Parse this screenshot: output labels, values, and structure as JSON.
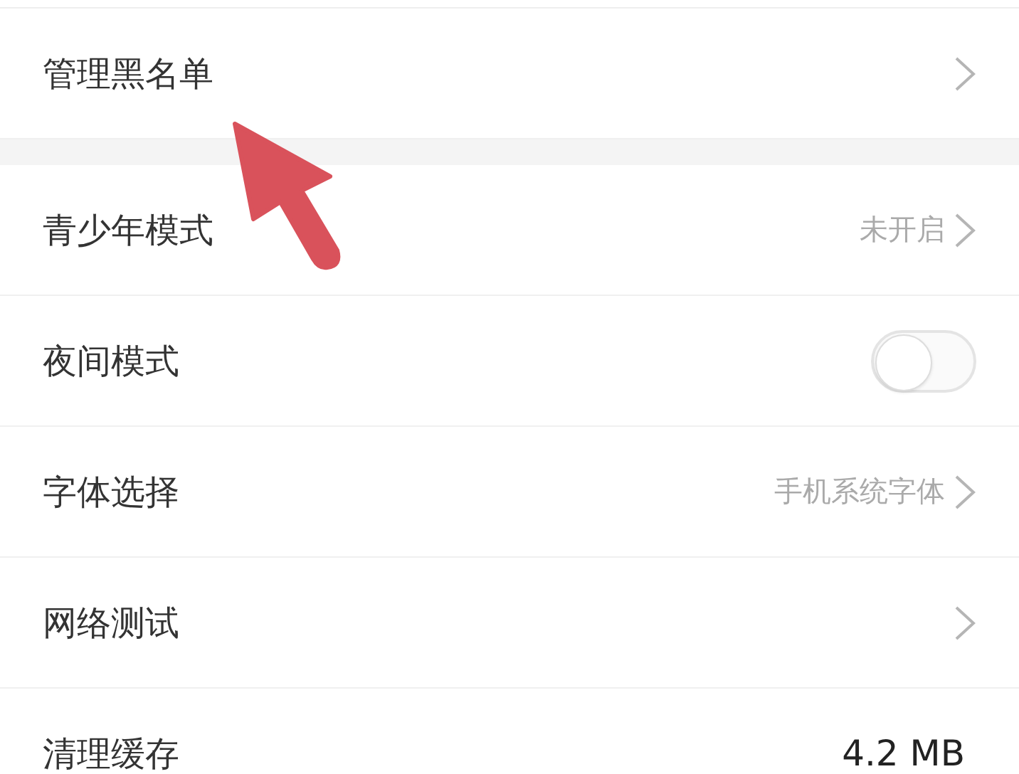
{
  "sections": [
    {
      "items": [
        {
          "kind": "link",
          "label": "管理黑名单"
        }
      ]
    },
    {
      "items": [
        {
          "kind": "link",
          "label": "青少年模式",
          "value": "未开启"
        },
        {
          "kind": "toggle",
          "label": "夜间模式",
          "on": false
        },
        {
          "kind": "link",
          "label": "字体选择",
          "value": "手机系统字体"
        },
        {
          "kind": "link",
          "label": "网络测试"
        },
        {
          "kind": "value",
          "label": "清理缓存",
          "value": "4.2 MB"
        }
      ]
    }
  ]
}
